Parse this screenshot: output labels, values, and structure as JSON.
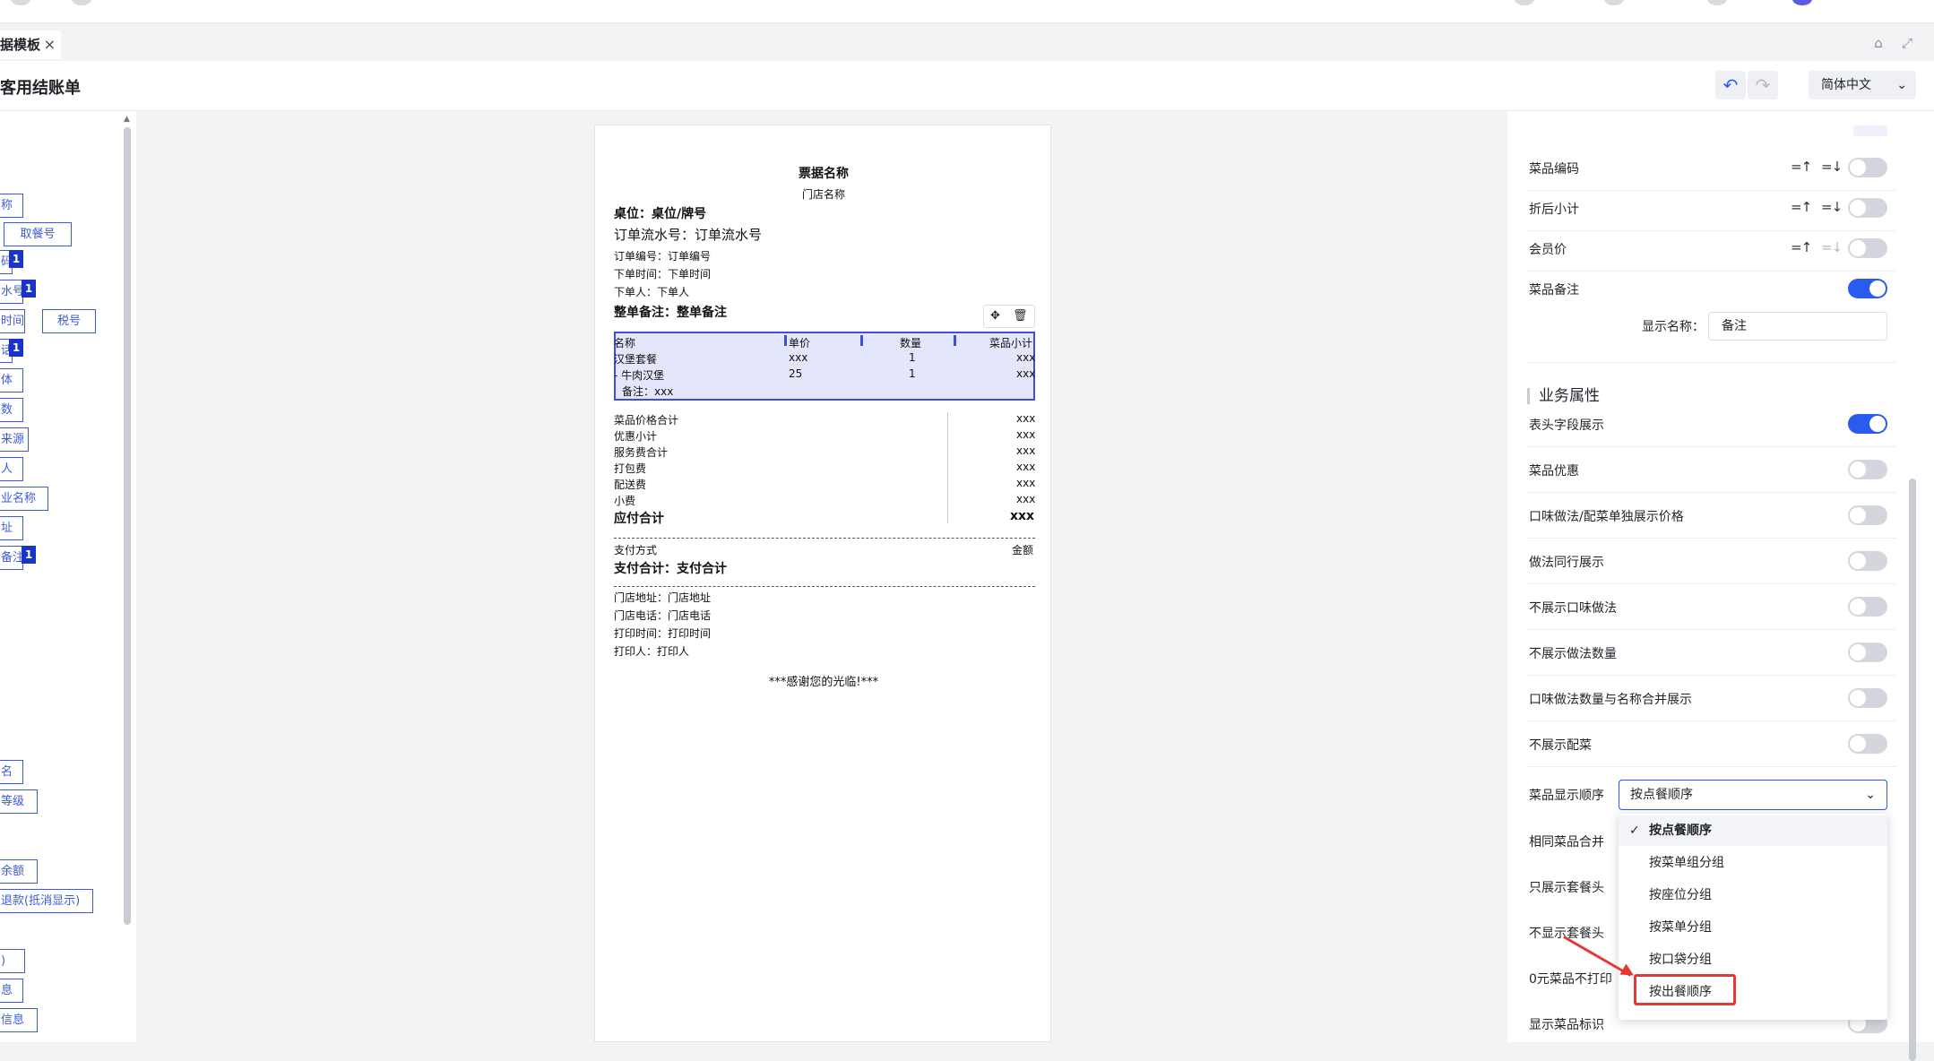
{
  "tab": {
    "label": "据模板",
    "close": "×"
  },
  "header": {
    "title": "客用结账单",
    "undo": "↶",
    "redo": "↷",
    "language": "简体中文",
    "chevron": "⌄"
  },
  "window_icons": {
    "pin": "⌂",
    "expand": "⤢"
  },
  "left_fields": [
    {
      "label": "称"
    },
    {
      "label": "取餐号"
    },
    {
      "label": "码",
      "badge": "1"
    },
    {
      "label": "水号",
      "badge": "1"
    },
    {
      "label": "时间"
    },
    {
      "label": "税号"
    },
    {
      "label": "话",
      "badge": "1"
    },
    {
      "label": "体"
    },
    {
      "label": "数"
    },
    {
      "label": "来源"
    },
    {
      "label": "人"
    },
    {
      "label": "业名称"
    },
    {
      "label": "址"
    },
    {
      "label": "备注",
      "badge": "1"
    },
    {
      "label": "名"
    },
    {
      "label": "等级"
    },
    {
      "label": "余额"
    },
    {
      "label": "退款(抵消显示)"
    },
    {
      "label": ")"
    },
    {
      "label": "息"
    },
    {
      "label": "信息"
    }
  ],
  "receipt": {
    "title": "票据名称",
    "store": "门店名称",
    "table": "桌位：桌位/牌号",
    "serial": "订单流水号：订单流水号",
    "order_no": "订单编号：订单编号",
    "order_time": "下单时间：下单时间",
    "order_person": "下单人：下单人",
    "whole_note": "整单备注：整单备注",
    "tools": {
      "move": "✥",
      "delete": "🗑"
    },
    "items_header": [
      "名称",
      "单价",
      "数量",
      "菜品小计"
    ],
    "items": [
      {
        "name": "汉堡套餐",
        "price": "xxx",
        "qty": "1",
        "subtotal": "xxx"
      },
      {
        "name": "- 牛肉汉堡",
        "price": "25",
        "qty": "1",
        "subtotal": "xxx"
      }
    ],
    "item_note": "备注：xxx",
    "summary": [
      {
        "label": "菜品价格合计",
        "value": "xxx"
      },
      {
        "label": "优惠小计",
        "value": "xxx"
      },
      {
        "label": "服务费合计",
        "value": "xxx"
      },
      {
        "label": "打包费",
        "value": "xxx"
      },
      {
        "label": "配送费",
        "value": "xxx"
      },
      {
        "label": "小费",
        "value": "xxx"
      }
    ],
    "total_label": "应付合计",
    "total_value": "xxx",
    "pay_method": "支付方式",
    "pay_amount": "金额",
    "pay_total": "支付合计：支付合计",
    "footer": [
      "门店地址：门店地址",
      "门店电话：门店电话",
      "打印时间：打印时间",
      "打印人：打印人"
    ],
    "thanks": "***感谢您的光临!***"
  },
  "right_panel": {
    "sort_up": "=↑",
    "sort_down": "=↓",
    "top_rows": [
      {
        "label": "菜品编码",
        "on": false,
        "sort_dim": false
      },
      {
        "label": "折后小计",
        "on": false,
        "sort_dim": false
      },
      {
        "label": "会员价",
        "on": false,
        "sort_dim": true
      },
      {
        "label": "菜品备注",
        "on": true
      }
    ],
    "display_name_label": "显示名称：",
    "display_name_value": "备注",
    "section_title": "业务属性",
    "biz_rows": [
      {
        "label": "表头字段展示",
        "on": true
      },
      {
        "label": "菜品优惠",
        "on": false
      },
      {
        "label": "口味做法/配菜单独展示价格",
        "on": false
      },
      {
        "label": "做法同行展示",
        "on": false
      },
      {
        "label": "不展示口味做法",
        "on": false
      },
      {
        "label": "不展示做法数量",
        "on": false
      },
      {
        "label": "口味做法数量与名称合并展示",
        "on": false
      },
      {
        "label": "不展示配菜",
        "on": false
      }
    ],
    "order_label": "菜品显示顺序",
    "order_value": "按点餐顺序",
    "hidden_rows": [
      "相同菜品合并",
      "只展示套餐头",
      "不显示套餐头",
      "0元菜品不打印"
    ],
    "last_row": "显示菜品标识",
    "menu_options": [
      "按点餐顺序",
      "按菜单组分组",
      "按座位分组",
      "按菜单分组",
      "按口袋分组",
      "按出餐顺序"
    ],
    "check": "✓"
  },
  "colors": {
    "accent": "#2a5bf0",
    "highlight": "#e53935",
    "selection": "#3d4fd6"
  }
}
